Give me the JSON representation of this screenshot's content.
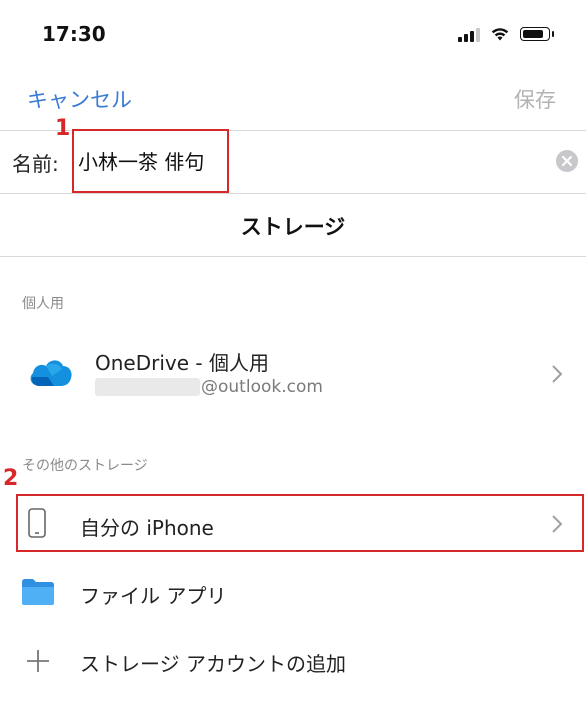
{
  "status": {
    "time": "17:30"
  },
  "nav": {
    "cancel_label": "キャンセル",
    "save_label": "保存"
  },
  "name_field": {
    "label": "名前:",
    "value": "小林一茶 俳句"
  },
  "storage_title": "ストレージ",
  "personal_section": {
    "header": "個人用",
    "item": {
      "title": "OneDrive - 個人用",
      "email": "@outlook.com"
    }
  },
  "other_section": {
    "header": "その他のストレージ",
    "items": [
      {
        "label": "自分の iPhone"
      },
      {
        "label": "ファイル アプリ"
      },
      {
        "label": "ストレージ アカウントの追加"
      }
    ]
  },
  "annotations": {
    "one": "1",
    "two": "2"
  },
  "colors": {
    "accent": "#3a7bd5",
    "annotation": "#d62828",
    "onedrive": "#0f6cbd",
    "folder": "#3ba3f0"
  }
}
